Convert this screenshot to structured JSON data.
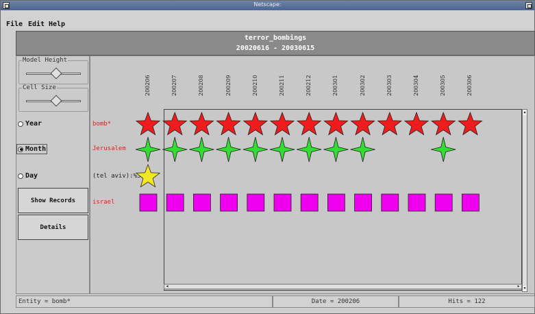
{
  "window": {
    "title": "Netscape:"
  },
  "menu": {
    "file": "File",
    "edit": "Edit",
    "help": "Help"
  },
  "header": {
    "title": "terror_bombings",
    "date_range": "20020616 - 20030615"
  },
  "controls": {
    "model_height_label": "Model Height",
    "cell_size_label": "Cell Size",
    "model_height_level": 0.55,
    "cell_size_level": 0.55,
    "radio_year": "Year",
    "radio_month": "Month",
    "radio_day": "Day",
    "selected_granularity": "Month",
    "show_records_label": "Show Records",
    "details_label": "Details"
  },
  "dates": [
    "200206",
    "200207",
    "200208",
    "200209",
    "200210",
    "200211",
    "200212",
    "200301",
    "200302",
    "200303",
    "200304",
    "200305",
    "200306"
  ],
  "rows": [
    {
      "label": "bomb*",
      "label_color": "#e02020",
      "shape": "star5",
      "fill": "#ee1c1c",
      "present": [
        1,
        1,
        1,
        1,
        1,
        1,
        1,
        1,
        1,
        1,
        1,
        1,
        1
      ]
    },
    {
      "label": "Jerusalem",
      "label_color": "#e02020",
      "shape": "star4",
      "fill": "#33dd33",
      "present": [
        1,
        1,
        1,
        1,
        1,
        1,
        1,
        1,
        1,
        0,
        0,
        1,
        0
      ]
    },
    {
      "label": "(tel aviv):%3",
      "label_color": "#222222",
      "shape": "star5",
      "fill": "#f2e822",
      "present": [
        1,
        0,
        0,
        0,
        0,
        0,
        0,
        0,
        0,
        0,
        0,
        0,
        0
      ]
    },
    {
      "label": "israel",
      "label_color": "#e02020",
      "shape": "square",
      "fill": "#ee00ee",
      "present": [
        1,
        1,
        1,
        1,
        1,
        1,
        1,
        1,
        1,
        1,
        1,
        1,
        1
      ]
    }
  ],
  "status": {
    "entity": "Entity = bomb*",
    "date": "Date = 200206",
    "hits": "Hits = 122"
  },
  "icons": {
    "scroll_up": "▴",
    "scroll_down": "▾",
    "scroll_left": "◂",
    "scroll_right": "▸"
  }
}
